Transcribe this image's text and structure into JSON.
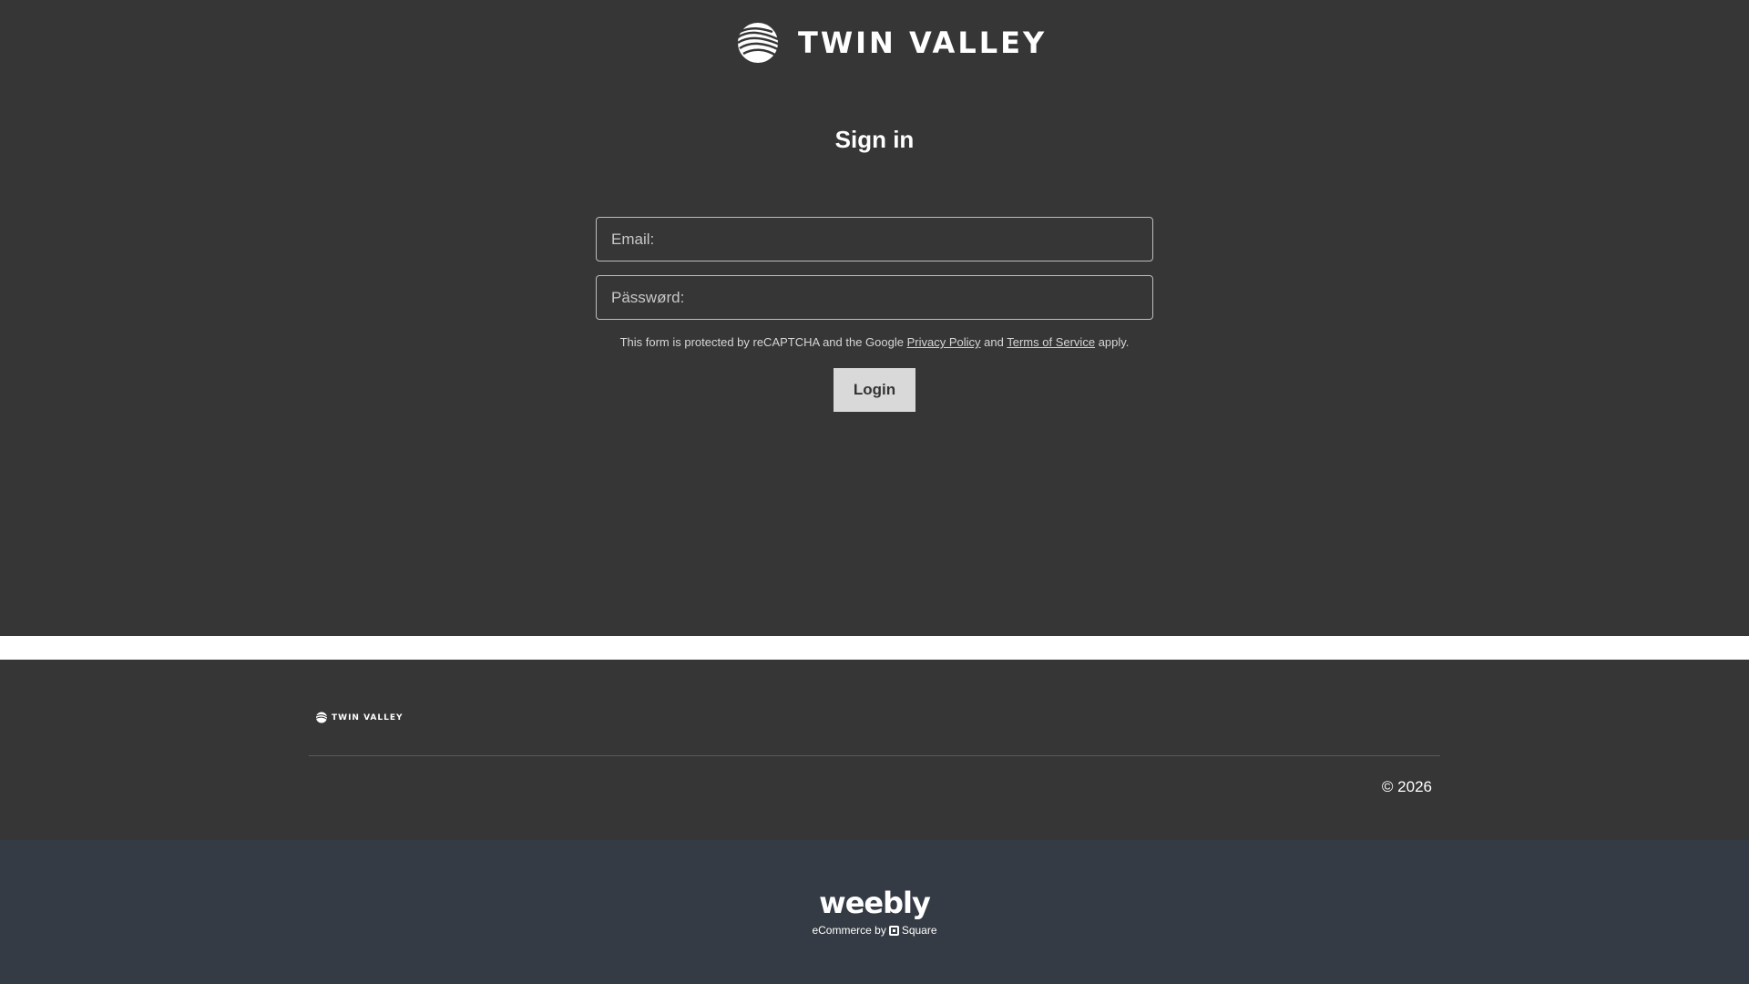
{
  "brand": {
    "name": "TWIN VALLEY",
    "logo_icon": "twin-valley-swoosh-icon"
  },
  "signin": {
    "title": "Sign in",
    "email_placeholder": "Email:",
    "email_value": "",
    "password_placeholder": "Pässwørd:",
    "password_value": "",
    "recaptcha_prefix": "This form is protected by reCAPTCHA and the Google",
    "privacy_link": "Privacy Policy",
    "and": "and",
    "terms_link": "Terms of Service",
    "recaptcha_suffix": "apply.",
    "login_label": "Login"
  },
  "footer": {
    "brand_name": "TWIN VALLEY",
    "copyright": "© 2026"
  },
  "weebly": {
    "word": "weebly",
    "sub_prefix": "eCommerce by",
    "sub_brand": "Square",
    "square_icon": "square-logo-icon"
  },
  "colors": {
    "background": "#363636",
    "button": "#d9d9d9",
    "weebly_bar": "#343b44"
  }
}
